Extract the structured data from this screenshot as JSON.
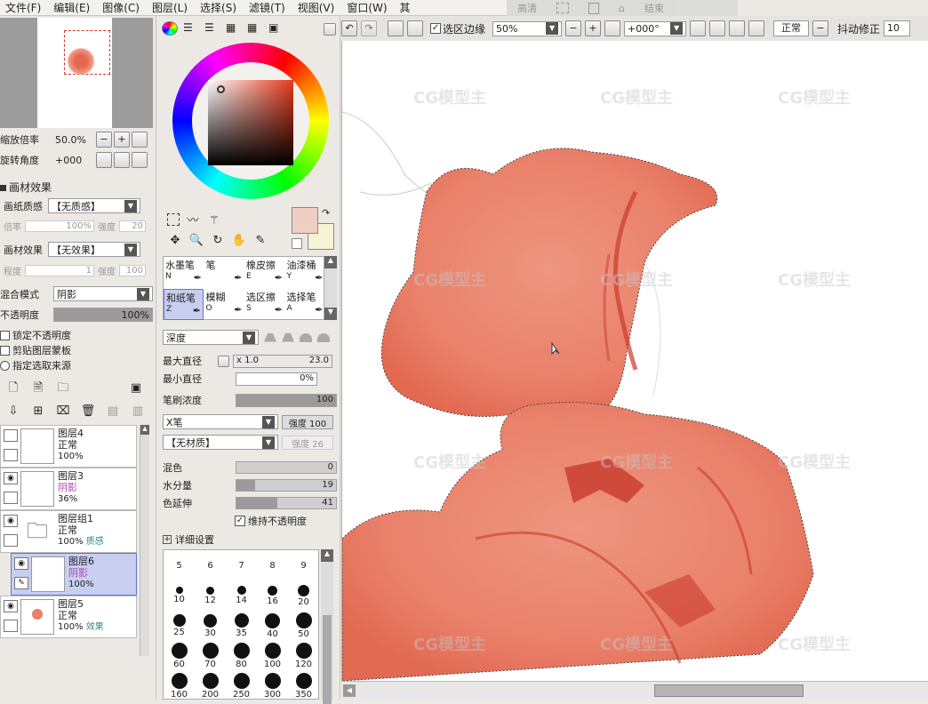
{
  "menu": [
    "文件(F)",
    "编辑(E)",
    "图像(C)",
    "图层(L)",
    "选择(S)",
    "滤镜(T)",
    "视图(V)",
    "窗口(W)",
    "其"
  ],
  "overlay_tabs": [
    "高清",
    "结束"
  ],
  "toolbar": {
    "selection_edge_label": "选区边缘",
    "zoom_value": "50%",
    "rotate_value": "+000°",
    "mode_value": "正常",
    "stabilizer_label": "抖动修正",
    "stabilizer_value": "10"
  },
  "navigator": {
    "zoom_label": "缩放倍率",
    "zoom_value": "50.0%",
    "rotate_label": "旋转角度",
    "rotate_value": "+000"
  },
  "texture_panel": {
    "title": "画材效果",
    "paper_label": "画纸质感",
    "paper_value": "【无质感】",
    "rate_label": "倍率",
    "rate_value": "100%",
    "strength_label": "强度",
    "strength_value": "20",
    "effect_label": "画材效果",
    "effect_value": "【无效果】",
    "degree_label": "程度",
    "degree_value": "1",
    "strength2_label": "强度",
    "strength2_value": "100"
  },
  "layer_props": {
    "blend_label": "混合模式",
    "blend_value": "阴影",
    "opacity_label": "不透明度",
    "opacity_value": "100%",
    "opacity_fill": 1.0,
    "checks": [
      "锁定不透明度",
      "剪贴图层蒙板",
      "指定选取来源"
    ]
  },
  "layers": [
    {
      "name": "图层4",
      "mode": "正常",
      "opacity": "100%",
      "selected": false
    },
    {
      "name": "图层3",
      "mode": "阴影",
      "opacity": "36%",
      "selected": false
    },
    {
      "name": "图层组1",
      "mode": "正常",
      "opacity": "100%",
      "extra": "质感",
      "selected": false
    },
    {
      "name": "图层6",
      "mode": "阴影",
      "opacity": "100%",
      "selected": true
    },
    {
      "name": "图层5",
      "mode": "正常",
      "opacity": "100%",
      "extra": "效果",
      "selected": false
    }
  ],
  "brush_tools": [
    {
      "name": "水墨笔",
      "key": "N"
    },
    {
      "name": "笔",
      "key": ""
    },
    {
      "name": "橡皮擦",
      "key": "E"
    },
    {
      "name": "油漆桶",
      "key": "Y"
    },
    {
      "name": "和纸笔",
      "key": "Z"
    },
    {
      "name": "模糊",
      "key": "O"
    },
    {
      "name": "选区擦",
      "key": "S"
    },
    {
      "name": "选择笔",
      "key": "A"
    }
  ],
  "brush_settings": {
    "shape_value": "深度",
    "max_size_label": "最大直径",
    "max_mult": "x 1.0",
    "max_size_value": "23.0",
    "min_size_label": "最小直径",
    "min_size_value": "0%",
    "density_label": "笔刷浓度",
    "density_value": "100",
    "density_fill": 1.0,
    "brush_shape": "X笔",
    "brush_strength_label": "强度",
    "brush_strength_value": "100",
    "texture_shape": "【无材质】",
    "texture_strength_label": "强度",
    "texture_strength_value": "26",
    "mix_label": "混色",
    "mix_value": "0",
    "mix_fill": 0.0,
    "water_label": "水分量",
    "water_value": "19",
    "water_fill": 0.19,
    "persist_label": "色延伸",
    "persist_value": "41",
    "persist_fill": 0.41,
    "keep_opacity_label": "维持不透明度",
    "detail_label": "详细设置"
  },
  "brush_sizes": [
    "5",
    "6",
    "7",
    "8",
    "9",
    "10",
    "12",
    "14",
    "16",
    "20",
    "25",
    "30",
    "35",
    "40",
    "50",
    "60",
    "70",
    "80",
    "100",
    "120",
    "160",
    "200",
    "250",
    "300",
    "350"
  ],
  "colors": {
    "current": "#efcfc2",
    "secondary": "#f7f2d5",
    "flower": "#e9806a",
    "accent": "#c93a2c"
  },
  "watermark": "CG模型主"
}
